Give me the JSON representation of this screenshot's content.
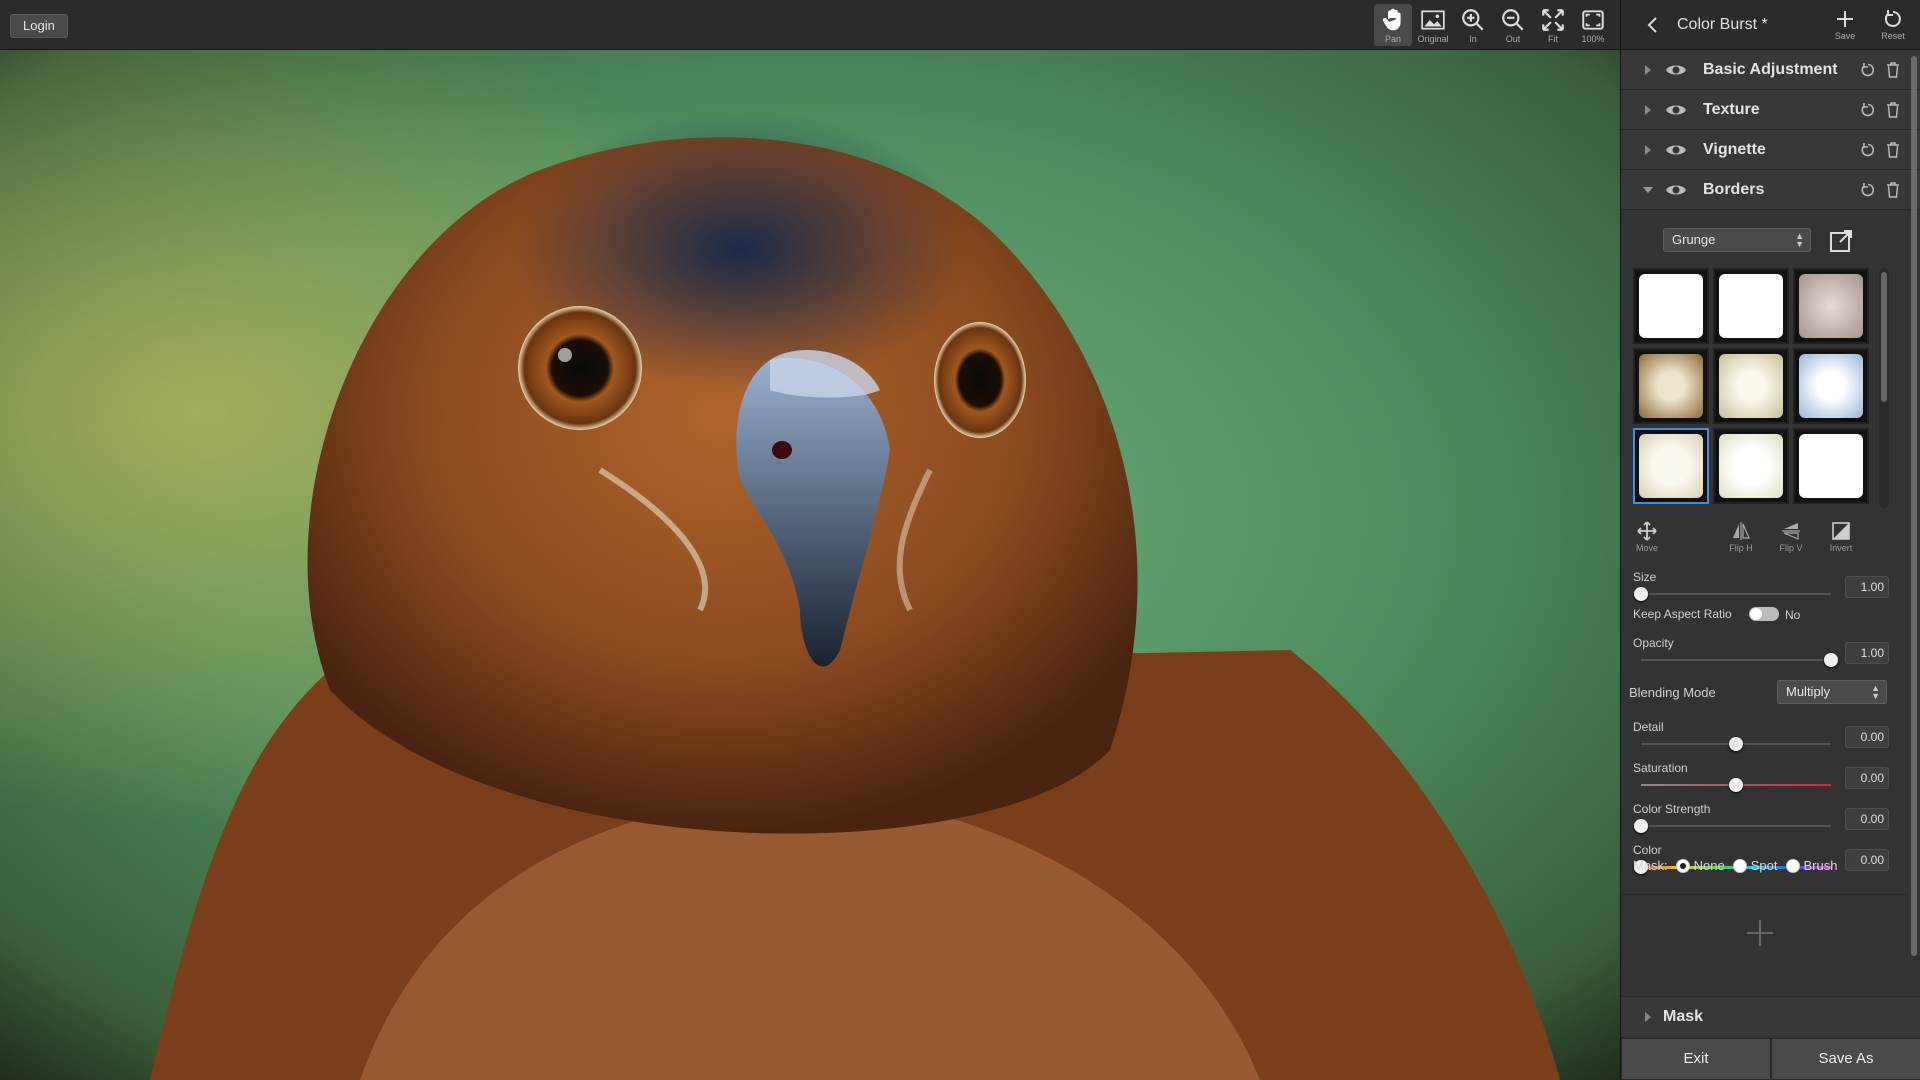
{
  "app": {
    "login_label": "Login"
  },
  "toolbar": {
    "tools": [
      {
        "id": "pan",
        "label": "Pan",
        "icon": "hand-icon",
        "active": true
      },
      {
        "id": "original",
        "label": "Original",
        "icon": "image-icon"
      },
      {
        "id": "in",
        "label": "In",
        "icon": "zoom-in-icon"
      },
      {
        "id": "out",
        "label": "Out",
        "icon": "zoom-out-icon"
      },
      {
        "id": "fit",
        "label": "Fit",
        "icon": "fit-icon"
      },
      {
        "id": "100",
        "label": "100%",
        "icon": "actual-size-icon"
      }
    ]
  },
  "panel": {
    "title": "Color Burst *",
    "save_label": "Save",
    "reset_label": "Reset",
    "layers": [
      {
        "name": "Basic Adjustment",
        "expanded": false
      },
      {
        "name": "Texture",
        "expanded": false
      },
      {
        "name": "Vignette",
        "expanded": false
      },
      {
        "name": "Borders",
        "expanded": true
      }
    ],
    "borders": {
      "preset": "Grunge",
      "thumbnails": [
        {
          "style": "white-rough",
          "selected": false
        },
        {
          "style": "white-rough-2",
          "selected": false
        },
        {
          "style": "mauve-soft",
          "selected": false
        },
        {
          "style": "tan-burned",
          "selected": false
        },
        {
          "style": "cream-soft",
          "selected": false
        },
        {
          "style": "light-blue-soft",
          "selected": false
        },
        {
          "style": "cream-light",
          "selected": true
        },
        {
          "style": "white-soft",
          "selected": false
        },
        {
          "style": "white-black-edge",
          "selected": false
        }
      ],
      "transform_buttons": [
        {
          "label": "Move",
          "icon": "move-icon"
        },
        {
          "label": "Flip H",
          "icon": "flip-horizontal-icon"
        },
        {
          "label": "Flip V",
          "icon": "flip-vertical-icon"
        },
        {
          "label": "Invert",
          "icon": "invert-icon"
        }
      ],
      "size": {
        "label": "Size",
        "value": "1.00",
        "position": 0.0
      },
      "keep_aspect": {
        "label": "Keep Aspect Ratio",
        "state": "No"
      },
      "opacity": {
        "label": "Opacity",
        "value": "1.00",
        "position": 1.0
      },
      "blending": {
        "label": "Blending Mode",
        "value": "Multiply"
      },
      "detail": {
        "label": "Detail",
        "value": "0.00",
        "position": 0.5
      },
      "saturation": {
        "label": "Saturation",
        "value": "0.00",
        "position": 0.5
      },
      "color_strength": {
        "label": "Color Strength",
        "value": "0.00",
        "position": 0.0
      },
      "color": {
        "label": "Color",
        "value": "0.00",
        "position": 0.0
      },
      "mask": {
        "label": "Mask:",
        "options": [
          "None",
          "Spot",
          "Brush"
        ],
        "selected": "None"
      }
    },
    "mask_section_label": "Mask",
    "exit_label": "Exit",
    "save_as_label": "Save As"
  },
  "colors": {
    "accent": "#3d8fe0",
    "panel_bg": "#333333",
    "toolbar_bg": "#2b2b2b"
  }
}
